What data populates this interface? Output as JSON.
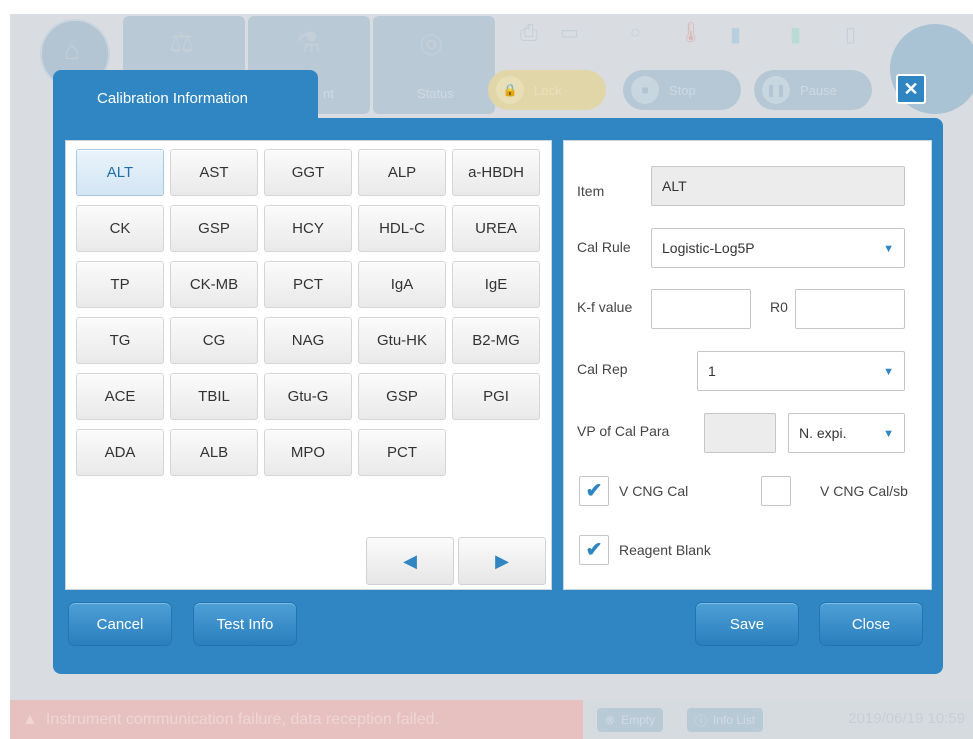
{
  "background": {
    "toolbar": {
      "status_label": "Status",
      "lock_label": "Lock",
      "stop_label": "Stop",
      "pause_label": "Pause",
      "partial_tab_label": "nt"
    },
    "statusbar": {
      "error_text": "Instrument communication failure, data reception failed.",
      "empty_label": "Empty",
      "info_list_label": "Info List",
      "datetime": "2019/06/19 10:59"
    }
  },
  "dialog": {
    "title": "Calibration Information",
    "close_icon": "close-x-icon",
    "tests": [
      "ALT",
      "AST",
      "GGT",
      "ALP",
      "a-HBDH",
      "CK",
      "GSP",
      "HCY",
      "HDL-C",
      "UREA",
      "TP",
      "CK-MB",
      "PCT",
      "IgA",
      "IgE",
      "TG",
      "CG",
      "NAG",
      "Gtu-HK",
      "B2-MG",
      "ACE",
      "TBIL",
      "Gtu-G",
      "GSP",
      "PGI",
      "ADA",
      "ALB",
      "MPO",
      "PCT"
    ],
    "selected_test_index": 0,
    "nav": {
      "prev_icon": "triangle-left-icon",
      "next_icon": "triangle-right-icon"
    },
    "form": {
      "item_label": "Item",
      "item_value": "ALT",
      "cal_rule_label": "Cal Rule",
      "cal_rule_value": "Logistic-Log5P",
      "kf_label": "K-f value",
      "kf_value": "",
      "r0_label": "R0",
      "r0_value": "",
      "cal_rep_label": "Cal Rep",
      "cal_rep_value": "1",
      "vp_label": "VP of Cal Para",
      "vp_value": "",
      "vp_unit_value": "N. expi.",
      "vcng_cal_label": "V CNG Cal",
      "vcng_cal_checked": true,
      "vcng_calsb_label": "V CNG Cal/sb",
      "vcng_calsb_checked": false,
      "reagent_blank_label": "Reagent Blank",
      "reagent_blank_checked": true
    },
    "footer": {
      "cancel": "Cancel",
      "test_info": "Test Info",
      "save": "Save",
      "close": "Close"
    },
    "colors": {
      "accent": "#2f86c3",
      "selected_text": "#1d6fa8"
    }
  }
}
